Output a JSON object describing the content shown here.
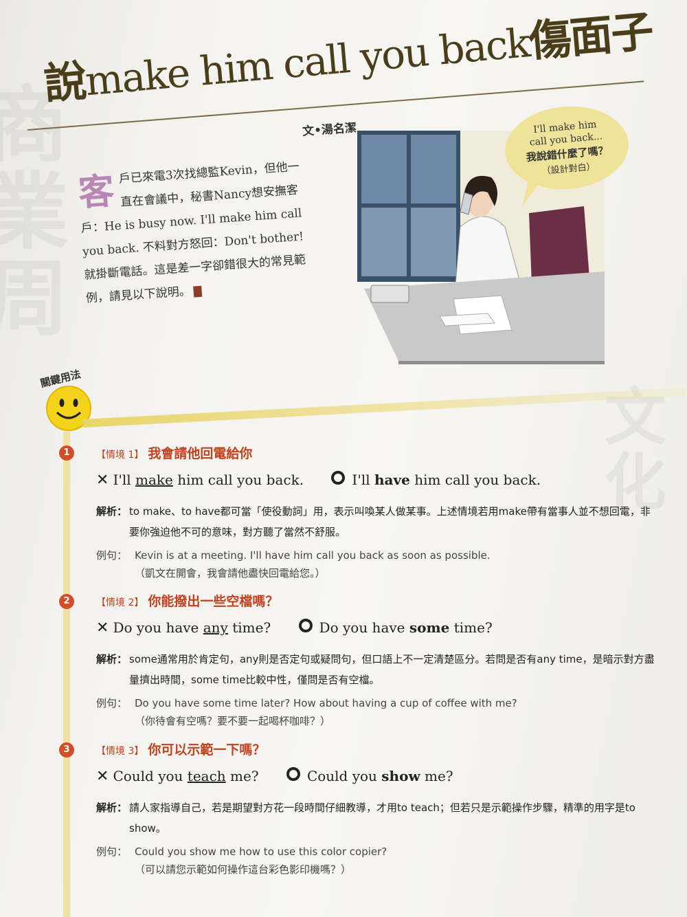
{
  "title": {
    "lead_cjk": "說",
    "english": "make him call you back",
    "tail_cjk": "傷面子"
  },
  "author": "文•湯名潔",
  "intro": {
    "drop_cap": "客",
    "text": "戶已來電3次找總監Kevin，但他一直在會議中，秘書Nancy想安撫客戶：He is busy now. I'll make him call you back. 不料對方怒回：Don't bother! 就掛斷電話。這是差一字卻錯很大的常見範例，請見以下說明。"
  },
  "speech_bubble": {
    "line1": "I'll make him",
    "line2": "call you back...",
    "line3": "我說錯什麼了嗎？",
    "line4": "（設計對白）"
  },
  "key_usage_label": "關鍵用法",
  "sections": [
    {
      "number": "1",
      "tag": "【情境 1】",
      "heading": "我會請他回電給你",
      "wrong": {
        "before": "I'll ",
        "key": "make",
        "after": " him call you back."
      },
      "right": {
        "before": "I'll ",
        "key": "have",
        "after": " him call you back."
      },
      "analysis_label": "解析：",
      "analysis": "to make、to have都可當「使役動詞」用，表示叫喚某人做某事。上述情境若用make帶有當事人並不想回電，非要你強迫他不可的意味，對方聽了當然不舒服。",
      "example_label": "例句：",
      "example_en": "Kevin is at a meeting. I'll have him call you back as soon as possible.",
      "example_zh": "（凱文在開會，我會請他盡快回電給您。）"
    },
    {
      "number": "2",
      "tag": "【情境 2】",
      "heading": "你能撥出一些空檔嗎？",
      "wrong": {
        "before": "Do you have ",
        "key": "any",
        "after": " time?"
      },
      "right": {
        "before": "Do you have ",
        "key": "some",
        "after": " time?"
      },
      "analysis_label": "解析：",
      "analysis": "some通常用於肯定句，any則是否定句或疑問句，但口語上不一定清楚區分。若問是否有any time，是暗示對方盡量擠出時間，some time比較中性，僅問是否有空檔。",
      "example_label": "例句：",
      "example_en": "Do you have some time later? How about having a cup of coffee with me?",
      "example_zh": "（你待會有空嗎？要不要一起喝杯咖啡？）"
    },
    {
      "number": "3",
      "tag": "【情境 3】",
      "heading": "你可以示範一下嗎？",
      "wrong": {
        "before": "Could you ",
        "key": "teach",
        "after": " me?"
      },
      "right": {
        "before": "Could you ",
        "key": "show",
        "after": " me?"
      },
      "analysis_label": "解析：",
      "analysis": "請人家指導自己，若是期望對方花一段時間仔細教導，才用to teach；但若只是示範操作步驟，精準的用字是to show。",
      "example_label": "例句：",
      "example_en": "Could you show me how to use this color copier?",
      "example_zh": "（可以請您示範如何操作這台彩色影印機嗎？）"
    }
  ]
}
